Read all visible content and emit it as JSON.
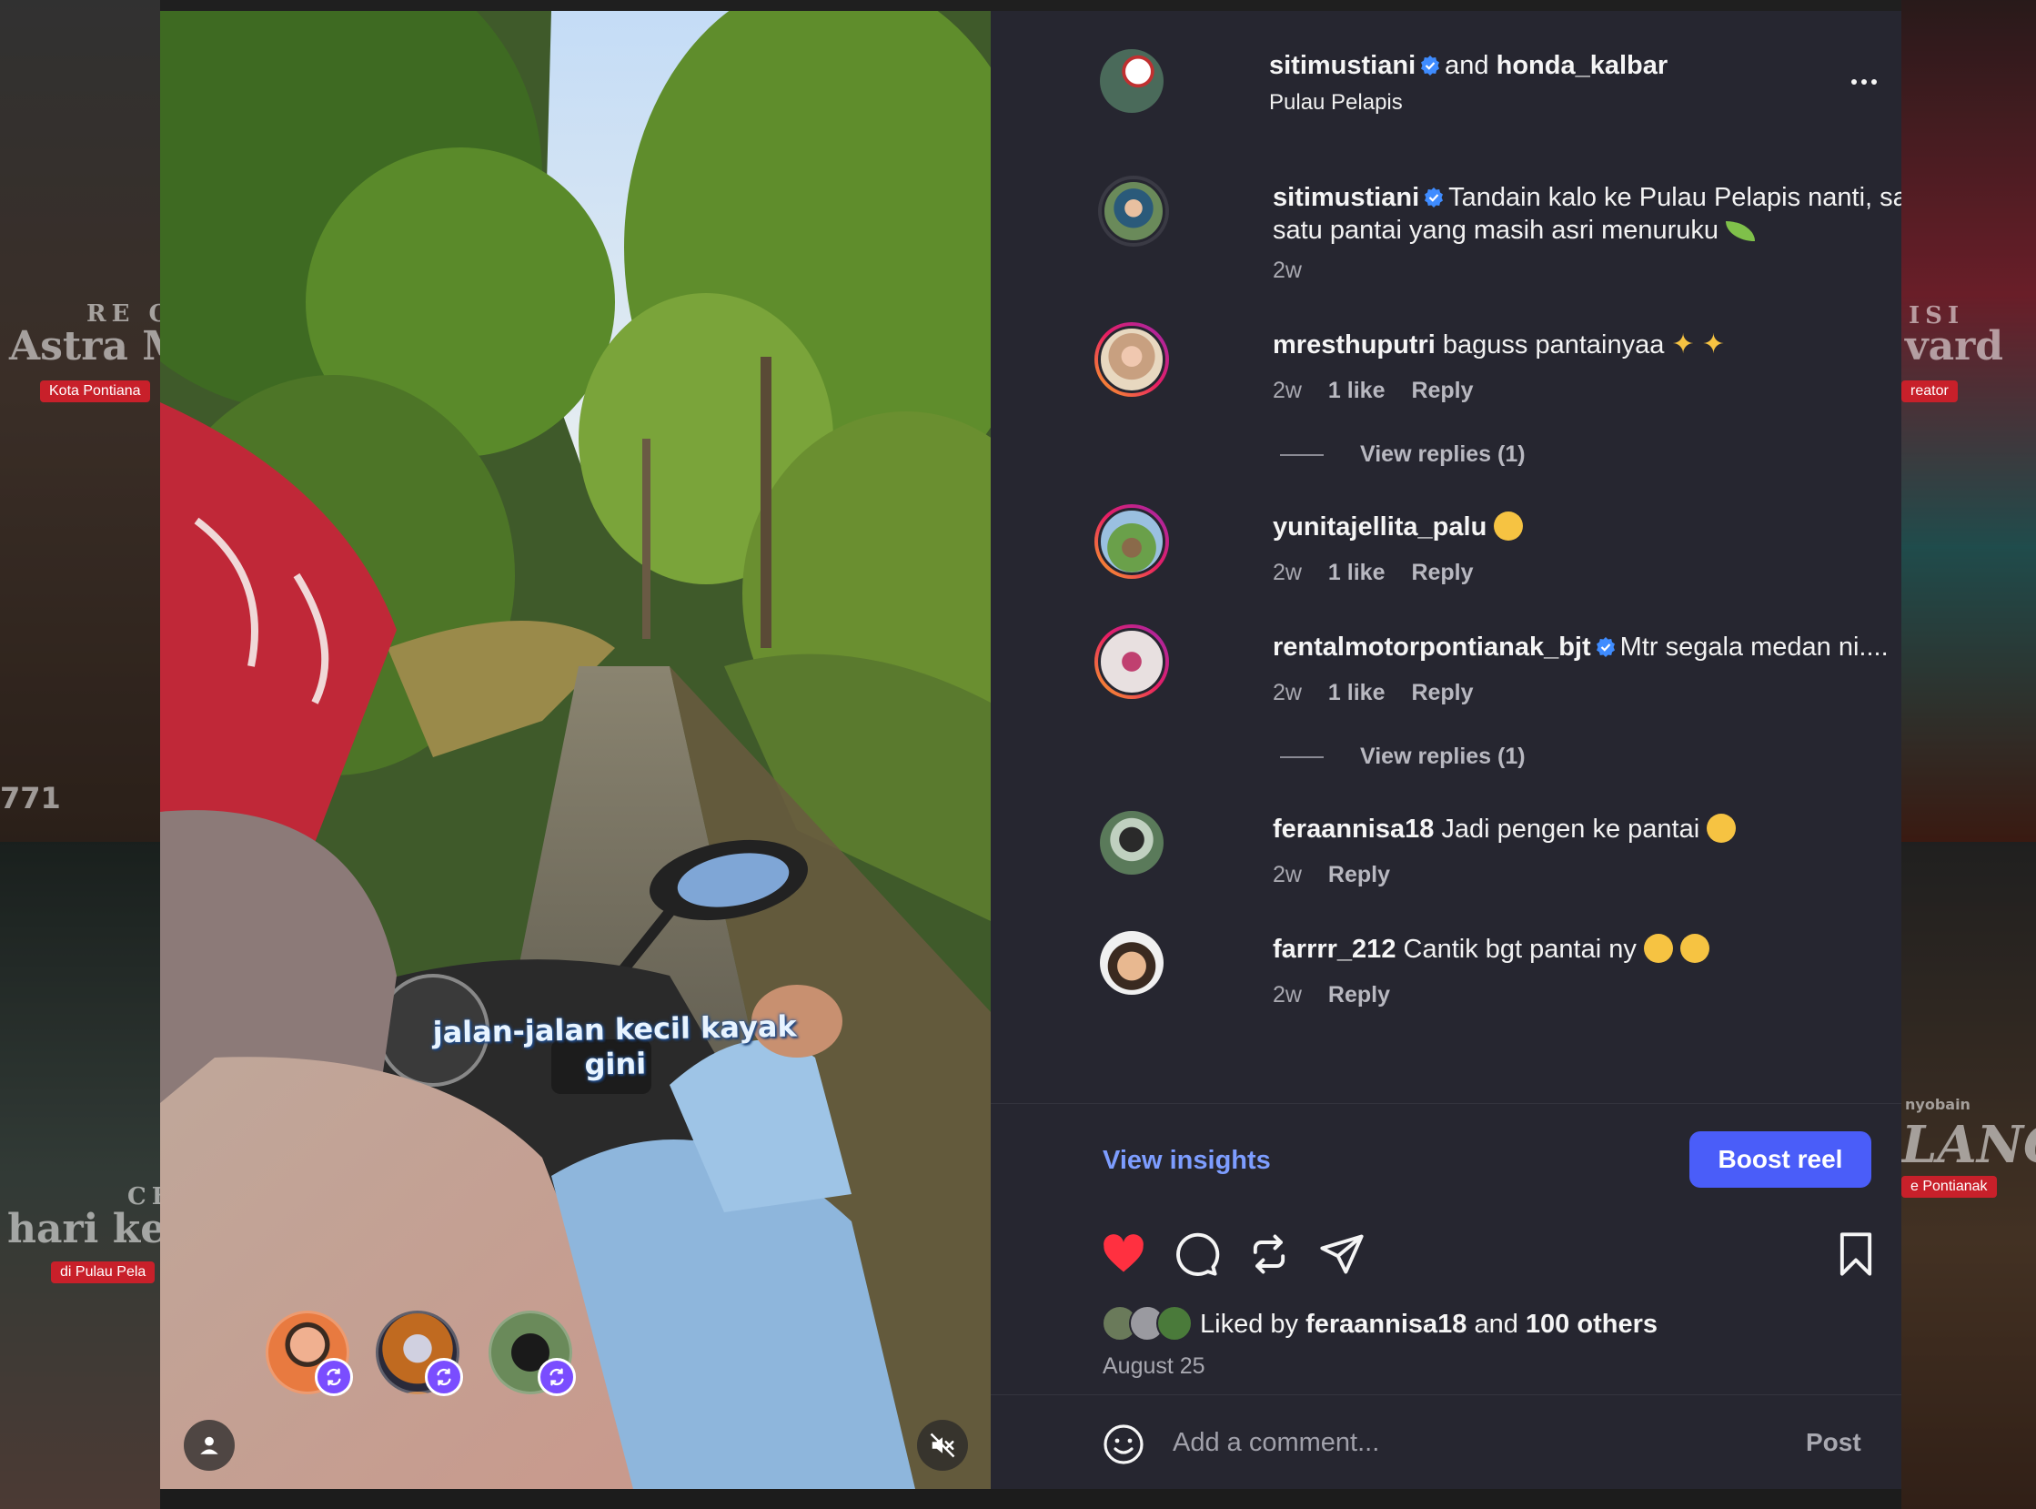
{
  "header": {
    "user1": "sitimustiani",
    "connector": "and",
    "user2": "honda_kalbar",
    "location": "Pulau Pelapis"
  },
  "video": {
    "caption_overlay": "jalan-jalan kecil kayak gini"
  },
  "comments": [
    {
      "username": "sitimustiani",
      "verified": true,
      "text": "Tandain kalo ke Pulau Pelapis nanti, salah satu pantai yang masih asri menuruku",
      "emoji": "leaf",
      "time": "2w"
    },
    {
      "username": "mresthuputri",
      "text": "baguss pantainyaa",
      "emoji": "sparkles",
      "time": "2w",
      "likes": "1 like",
      "reply": "Reply",
      "liked": true,
      "view_replies": "View replies (1)"
    },
    {
      "username": "yunitajellita_palu",
      "text": "",
      "emoji": "heart-eyes",
      "time": "2w",
      "likes": "1 like",
      "reply": "Reply",
      "liked": true
    },
    {
      "username": "rentalmotorpontianak_bjt",
      "verified": true,
      "text": "Mtr segala medan ni....",
      "time": "2w",
      "likes": "1 like",
      "reply": "Reply",
      "liked": true,
      "view_replies": "View replies (1)"
    },
    {
      "username": "feraannisa18",
      "text": "Jadi pengen ke pantai",
      "emoji": "heart-eyes",
      "time": "2w",
      "reply": "Reply",
      "liked": false
    },
    {
      "username": "farrrr_212",
      "text": "Cantik bgt pantai ny",
      "emoji": "heart-eyes x2",
      "time": "2w",
      "reply": "Reply",
      "liked": false
    }
  ],
  "insights": {
    "view_insights": "View insights",
    "boost": "Boost reel"
  },
  "likes_summary": {
    "prefix": "Liked by",
    "user": "feraannisa18",
    "and": "and",
    "others": "100 others",
    "date": "August 25"
  },
  "comment_box": {
    "placeholder": "Add a comment...",
    "post": "Post"
  },
  "background": {
    "left_top_text": "Astra Mo",
    "left_top_small": "RE O",
    "left_top_chip": "Kota Pontiana",
    "left_number": "771",
    "left_bottom_small": "CE",
    "left_bottom_text": "hari ken",
    "left_bottom_chip": "di Pulau Pela",
    "right_top_small": "ISI",
    "right_top_text": "vard",
    "right_top_chip": "reator",
    "right_bottom_small": "nyobain",
    "right_bottom_text": "LANC",
    "right_bottom_chip": "e Pontianak"
  },
  "colors": {
    "panel_bg": "#262630",
    "accent_blue": "#4a5df9",
    "link_blue": "#7d9dff",
    "like_red": "#ff3040",
    "verified_blue": "#3f8cff"
  }
}
